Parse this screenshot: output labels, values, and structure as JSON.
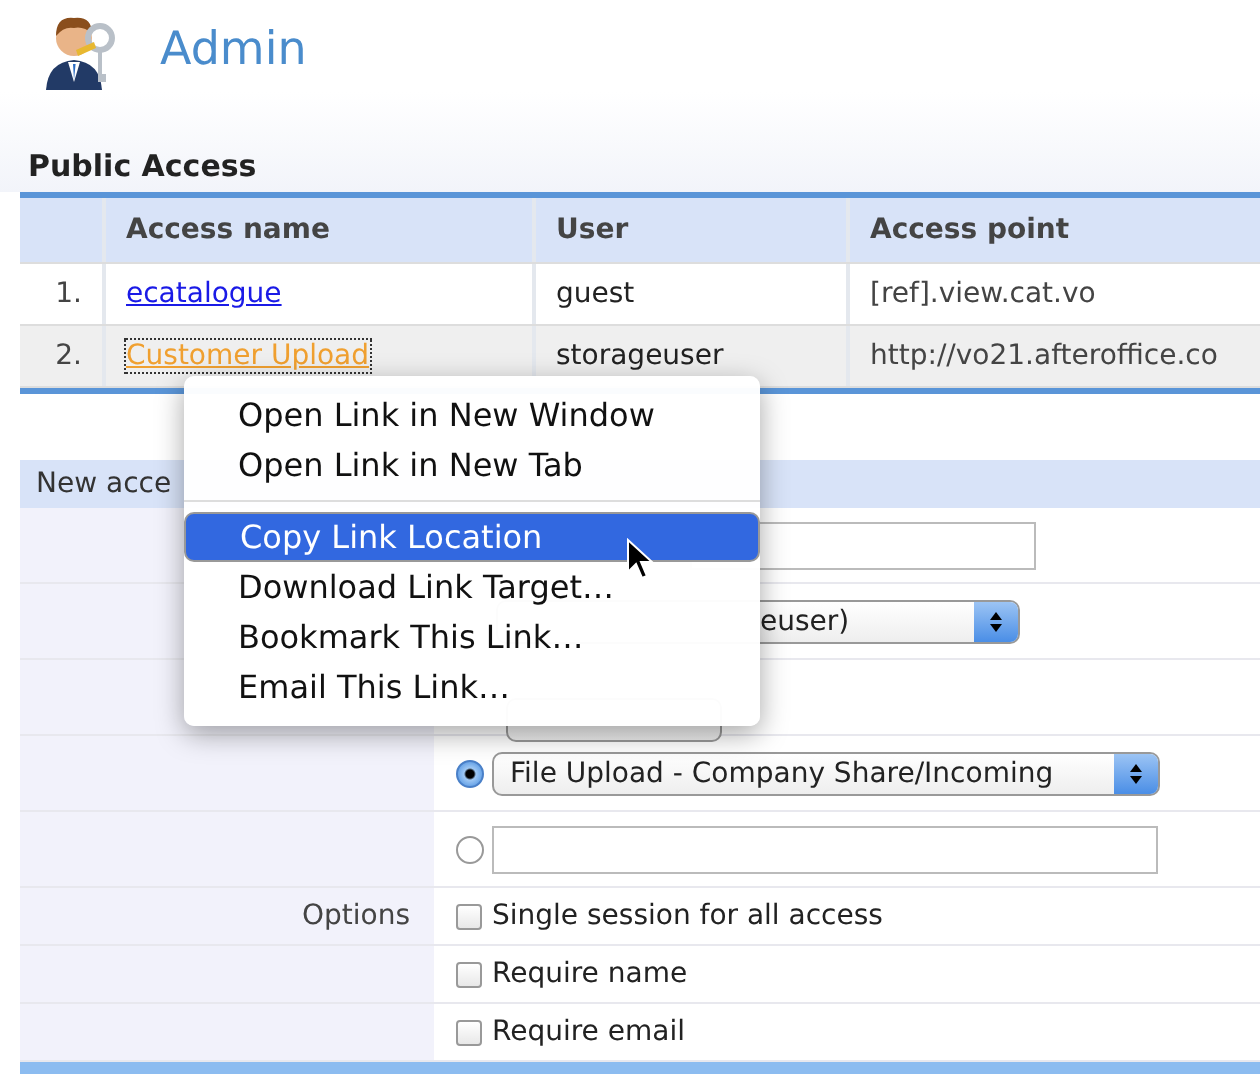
{
  "header": {
    "title": "Admin"
  },
  "public_access": {
    "title": "Public Access",
    "columns": [
      "Access name",
      "User",
      "Access point"
    ],
    "rows": [
      {
        "index": "1.",
        "name": "ecatalogue",
        "user": "guest",
        "access_point": "[ref].view.cat.vo",
        "focused": false
      },
      {
        "index": "2.",
        "name": "Customer Upload",
        "user": "storageuser",
        "access_point": "http://vo21.afteroffice.co",
        "focused": true
      }
    ]
  },
  "new_access": {
    "title": "New acce",
    "fields": [
      {
        "kind": "text"
      },
      {
        "kind": "select",
        "value": "euser)"
      },
      {
        "kind": "select"
      },
      {
        "kind": "radio_select",
        "selected": true,
        "value": "File Upload - Company Share/Incoming"
      },
      {
        "kind": "radio_text",
        "selected": false
      }
    ],
    "options": {
      "label": "Options",
      "checkboxes": [
        {
          "label": "Single session for all access",
          "checked": false
        },
        {
          "label": "Require name",
          "checked": false
        },
        {
          "label": "Require email",
          "checked": false
        }
      ]
    }
  },
  "context_menu": {
    "items": [
      {
        "kind": "item",
        "label": "Open Link in New Window",
        "selected": false
      },
      {
        "kind": "item",
        "label": "Open Link in New Tab",
        "selected": false
      },
      {
        "kind": "separator"
      },
      {
        "kind": "item",
        "label": "Copy Link Location",
        "selected": true
      },
      {
        "kind": "item",
        "label": "Download Link Target…",
        "selected": false
      },
      {
        "kind": "item",
        "label": "Bookmark This Link…",
        "selected": false
      },
      {
        "kind": "item",
        "label": "Email This Link…",
        "selected": false
      }
    ]
  }
}
